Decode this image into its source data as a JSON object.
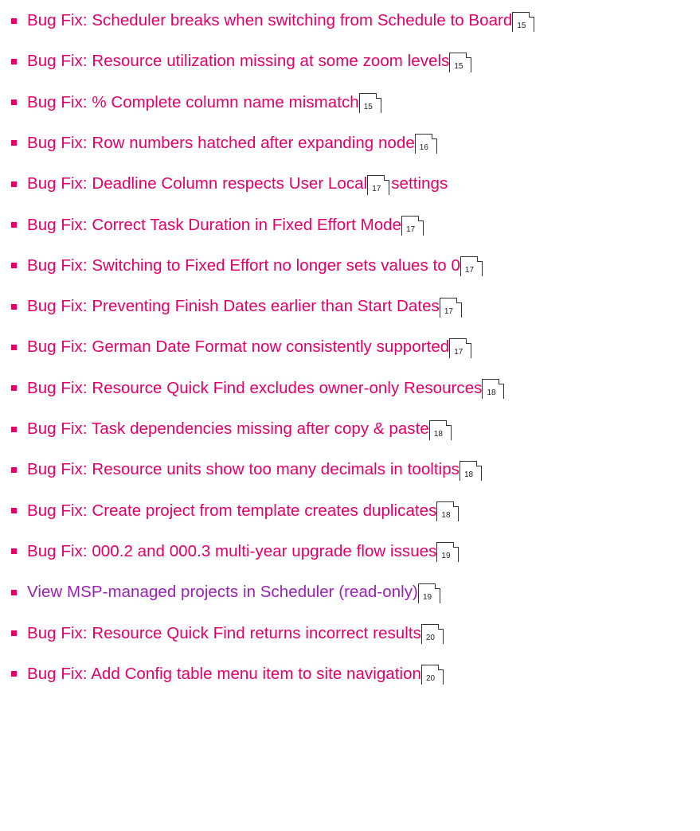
{
  "colors": {
    "bug_fix_text": "#e2006a",
    "feature_text": "#9b22b5",
    "bullet": "#e2006a"
  },
  "bullet_icon": "square-bullet-icon",
  "page_icon": "page-reference-icon",
  "toc": {
    "items": [
      {
        "text": "Bug Fix: Scheduler breaks when switching from Schedule to Board",
        "page": "15",
        "tail": ""
      },
      {
        "text": "Bug Fix: Resource utilization missing at some zoom levels",
        "page": "15",
        "tail": ""
      },
      {
        "text": "Bug Fix: % Complete column name mismatch",
        "page": "15",
        "tail": ""
      },
      {
        "text": "Bug Fix: Row numbers hatched after expanding node",
        "page": "16",
        "tail": ""
      },
      {
        "text": "Bug Fix: Deadline Column respects User Local",
        "page": "17",
        "tail": "settings"
      },
      {
        "text": "Bug Fix: Correct Task Duration in Fixed Effort Mode",
        "page": "17",
        "tail": ""
      },
      {
        "text": "Bug Fix: Switching to Fixed Effort no longer sets values to 0",
        "page": "17",
        "tail": ""
      },
      {
        "text": "Bug Fix: Preventing Finish Dates earlier than Start Dates",
        "page": "17",
        "tail": ""
      },
      {
        "text": "Bug Fix: German Date Format now consistently supported",
        "page": "17",
        "tail": ""
      },
      {
        "text": "Bug Fix: Resource Quick Find excludes owner-only Resources",
        "page": "18",
        "tail": ""
      },
      {
        "text": "Bug Fix: Task dependencies missing after copy & paste",
        "page": "18",
        "tail": ""
      },
      {
        "text": "Bug Fix: Resource units show too many decimals in tooltips",
        "page": "18",
        "tail": ""
      },
      {
        "text": "Bug Fix: Create project from template creates duplicates",
        "page": "18",
        "tail": ""
      },
      {
        "text": "Bug Fix: 000.2 and 000.3 multi-year upgrade flow issues",
        "page": "19",
        "tail": ""
      },
      {
        "text": "View MSP-managed projects in Scheduler (read-only)",
        "page": "19",
        "tail": ""
      },
      {
        "text": "Bug Fix: Resource Quick Find returns incorrect results",
        "page": "20",
        "tail": ""
      },
      {
        "text": "Bug Fix: Add Config table menu item to site navigation",
        "page": "20",
        "tail": ""
      }
    ]
  }
}
